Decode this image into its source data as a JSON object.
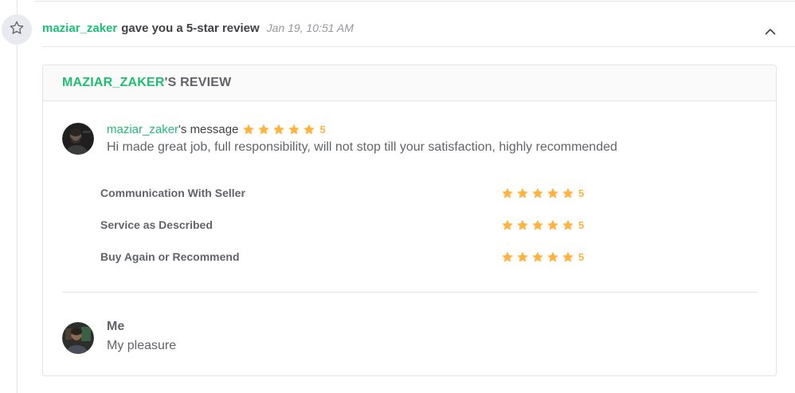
{
  "event": {
    "icon": "star-outline-icon",
    "user": "maziar_zaker",
    "text": "gave you a 5-star review",
    "time": "Jan 19, 10:51 AM",
    "collapse_icon": "chevron-up-icon"
  },
  "review": {
    "header_user": "MAZIAR_ZAKER",
    "header_suffix": "'S REVIEW",
    "message": {
      "user": "maziar_zaker",
      "suffix": "'s message",
      "rating": 5,
      "rating_label": "5",
      "body": "Hi made great job, full responsibility, will not stop till your satisfaction, highly recommended"
    },
    "breakdown": [
      {
        "label": "Communication With Seller",
        "rating": 5,
        "rating_label": "5"
      },
      {
        "label": "Service as Described",
        "rating": 5,
        "rating_label": "5"
      },
      {
        "label": "Buy Again or Recommend",
        "rating": 5,
        "rating_label": "5"
      }
    ],
    "reply": {
      "name": "Me",
      "body": "My pleasure"
    }
  },
  "colors": {
    "accent": "#1dbf73",
    "star": "#ffb33e",
    "text": "#404145",
    "muted": "#95979d"
  }
}
